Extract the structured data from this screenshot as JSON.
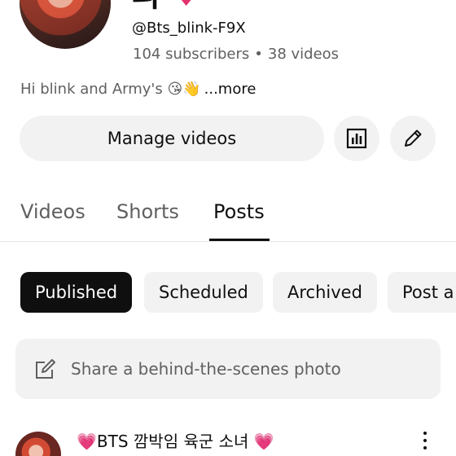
{
  "channel": {
    "name_partial": "리",
    "handle": "@Bts_blink-F9X",
    "subscribers": "104 subscribers",
    "separator": "•",
    "videos": "38 videos",
    "description": "Hi blink and Army's 😘👋",
    "more_label": "...more"
  },
  "actions": {
    "manage_videos": "Manage videos"
  },
  "tabs": [
    {
      "label": "Videos"
    },
    {
      "label": "Shorts"
    },
    {
      "label": "Posts"
    }
  ],
  "filters": [
    {
      "label": "Published"
    },
    {
      "label": "Scheduled"
    },
    {
      "label": "Archived"
    },
    {
      "label": "Post a"
    }
  ],
  "share": {
    "placeholder": "Share a behind-the-scenes photo"
  },
  "post": {
    "title": "💗BTS 깜박임 육군 소녀 💗"
  },
  "colors": {
    "chip_bg": "#f2f2f2",
    "selected_chip_bg": "#0f0f0f",
    "secondary_text": "#606060",
    "heart": "#e3326b"
  },
  "icons": {
    "analytics": "bar-chart-icon",
    "edit": "pencil-icon",
    "share": "compose-icon",
    "more": "vertical-dots-icon"
  }
}
